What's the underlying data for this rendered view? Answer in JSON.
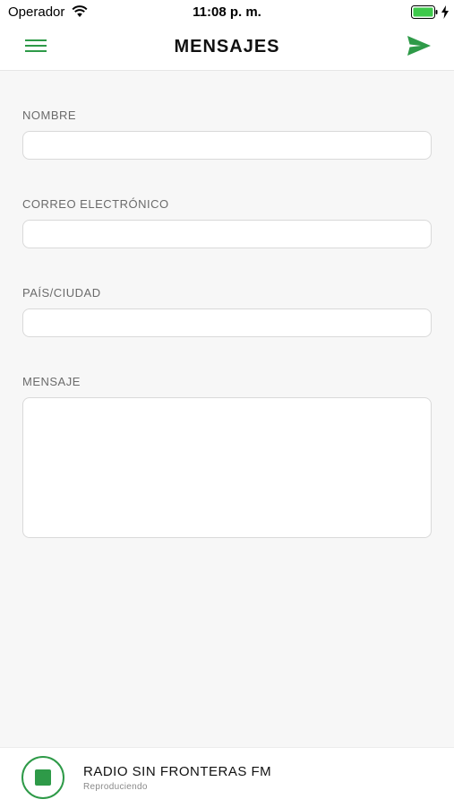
{
  "status_bar": {
    "carrier": "Operador",
    "time": "11:08 p. m.",
    "icons": [
      "wifi-icon",
      "battery-icon",
      "charging-icon"
    ]
  },
  "nav": {
    "title": "MENSAJES",
    "menu_icon": "hamburger-icon",
    "send_icon": "send-icon"
  },
  "form": {
    "name_label": "NOMBRE",
    "name_value": "",
    "email_label": "CORREO ELECTRÓNICO",
    "email_value": "",
    "location_label": "PAÍS/CIUDAD",
    "location_value": "",
    "message_label": "MENSAJE",
    "message_value": ""
  },
  "player": {
    "station": "RADIO SIN FRONTERAS FM",
    "status": "Reproduciendo",
    "button_icon": "stop-icon"
  },
  "colors": {
    "accent": "#2e9a48",
    "background": "#f7f7f7",
    "bar_background": "#ffffff"
  }
}
